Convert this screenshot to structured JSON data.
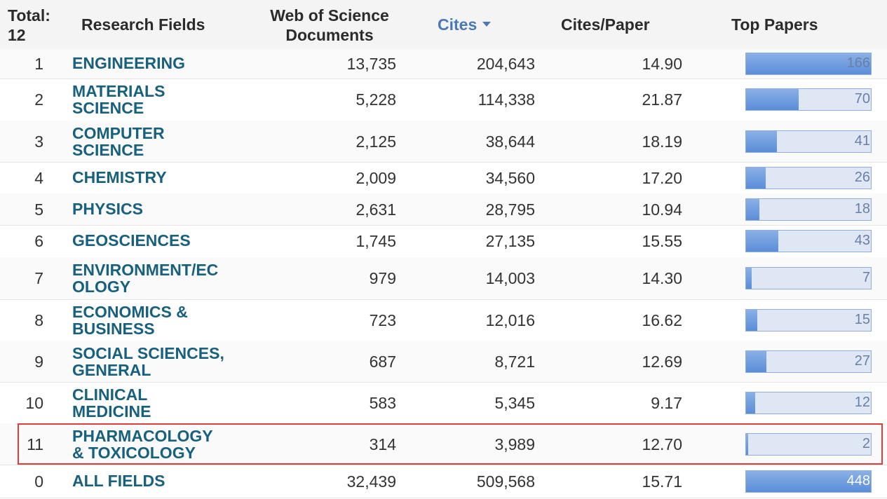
{
  "header": {
    "total_label": "Total:",
    "total_value": "12",
    "fields_label": "Research Fields",
    "docs_label_line1": "Web of Science",
    "docs_label_line2": "Documents",
    "cites_label": "Cites",
    "cpp_label": "Cites/Paper",
    "top_label": "Top Papers"
  },
  "rows": [
    {
      "rank": "1",
      "field_line1": "ENGINEERING",
      "field_line2": "",
      "docs": "13,735",
      "cites": "204,643",
      "cpp": "14.90",
      "top": "166",
      "top_value": 166
    },
    {
      "rank": "2",
      "field_line1": "MATERIALS",
      "field_line2": "SCIENCE",
      "docs": "5,228",
      "cites": "114,338",
      "cpp": "21.87",
      "top": "70",
      "top_value": 70
    },
    {
      "rank": "3",
      "field_line1": "COMPUTER",
      "field_line2": "SCIENCE",
      "docs": "2,125",
      "cites": "38,644",
      "cpp": "18.19",
      "top": "41",
      "top_value": 41
    },
    {
      "rank": "4",
      "field_line1": "CHEMISTRY",
      "field_line2": "",
      "docs": "2,009",
      "cites": "34,560",
      "cpp": "17.20",
      "top": "26",
      "top_value": 26
    },
    {
      "rank": "5",
      "field_line1": "PHYSICS",
      "field_line2": "",
      "docs": "2,631",
      "cites": "28,795",
      "cpp": "10.94",
      "top": "18",
      "top_value": 18
    },
    {
      "rank": "6",
      "field_line1": "GEOSCIENCES",
      "field_line2": "",
      "docs": "1,745",
      "cites": "27,135",
      "cpp": "15.55",
      "top": "43",
      "top_value": 43
    },
    {
      "rank": "7",
      "field_line1": "ENVIRONMENT/EC",
      "field_line2": "OLOGY",
      "docs": "979",
      "cites": "14,003",
      "cpp": "14.30",
      "top": "7",
      "top_value": 7
    },
    {
      "rank": "8",
      "field_line1": "ECONOMICS &",
      "field_line2": "BUSINESS",
      "docs": "723",
      "cites": "12,016",
      "cpp": "16.62",
      "top": "15",
      "top_value": 15
    },
    {
      "rank": "9",
      "field_line1": "SOCIAL SCIENCES,",
      "field_line2": "GENERAL",
      "docs": "687",
      "cites": "8,721",
      "cpp": "12.69",
      "top": "27",
      "top_value": 27
    },
    {
      "rank": "10",
      "field_line1": "CLINICAL",
      "field_line2": "MEDICINE",
      "docs": "583",
      "cites": "5,345",
      "cpp": "9.17",
      "top": "12",
      "top_value": 12
    },
    {
      "rank": "11",
      "field_line1": "PHARMACOLOGY",
      "field_line2": "& TOXICOLOGY",
      "docs": "314",
      "cites": "3,989",
      "cpp": "12.70",
      "top": "2",
      "top_value": 2
    },
    {
      "rank": "0",
      "field_line1": "ALL FIELDS",
      "field_line2": "",
      "docs": "32,439",
      "cites": "509,568",
      "cpp": "15.71",
      "top": "448",
      "top_value": 448
    }
  ],
  "colors": {
    "field_link": "#17607e",
    "sort_header": "#4a79b5",
    "highlight_border": "#e03c3c",
    "bar_fill": "#5a8dd8",
    "bar_track": "#dfe7f5"
  }
}
